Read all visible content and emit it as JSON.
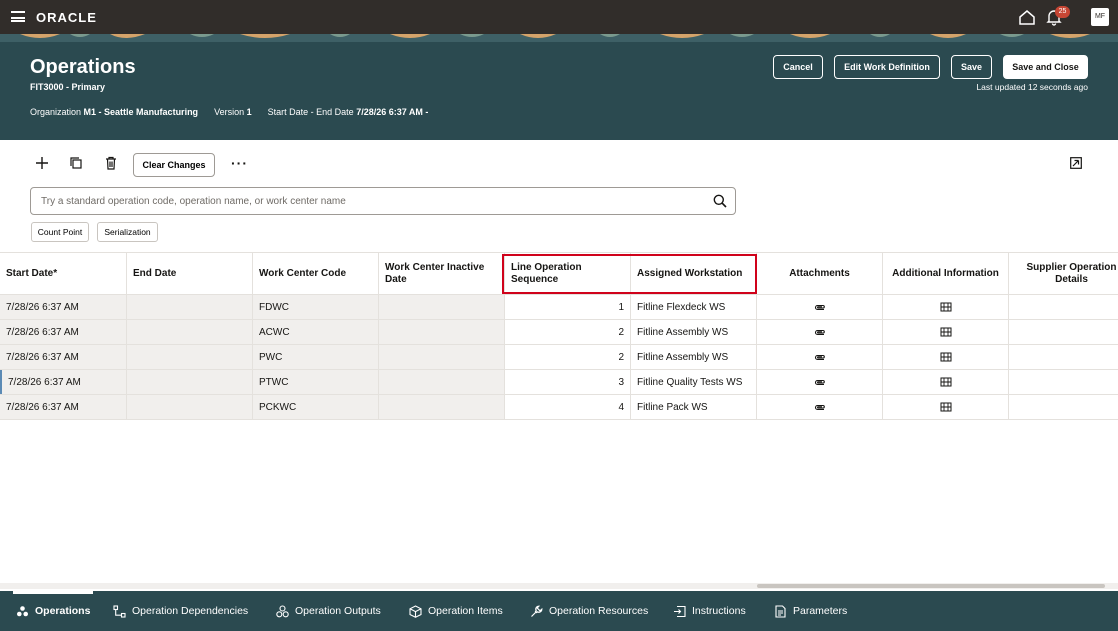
{
  "topbar": {
    "logo": "ORACLE",
    "notification_count": "25",
    "avatar_initials": "MF"
  },
  "header": {
    "title": "Operations",
    "subtitle": "FIT3000 - Primary",
    "organization_label": "Organization",
    "organization_value": "M1 - Seattle Manufacturing",
    "version_label": "Version",
    "version_value": "1",
    "dates_label": "Start Date - End Date",
    "dates_value": "7/28/26 6:37 AM -",
    "last_updated": "Last updated 12 seconds ago",
    "buttons": {
      "cancel": "Cancel",
      "edit_work_definition": "Edit Work Definition",
      "save": "Save",
      "save_and_close": "Save and Close"
    }
  },
  "toolbar": {
    "clear_changes": "Clear Changes"
  },
  "search": {
    "placeholder": "Try a standard operation code, operation name, or work center name"
  },
  "chips": [
    "Count Point",
    "Serialization"
  ],
  "table": {
    "columns": [
      "Start Date*",
      "End Date",
      "Work Center Code",
      "Work Center Inactive Date",
      "Line Operation Sequence",
      "Assigned Workstation",
      "Attachments",
      "Additional Information",
      "Supplier Operation Details"
    ],
    "rows": [
      {
        "start_date": "7/28/26 6:37 AM",
        "end_date": "",
        "work_center_code": "FDWC",
        "inactive_date": "",
        "line_seq": "1",
        "workstation": "Fitline Flexdeck WS"
      },
      {
        "start_date": "7/28/26 6:37 AM",
        "end_date": "",
        "work_center_code": "ACWC",
        "inactive_date": "",
        "line_seq": "2",
        "workstation": "Fitline Assembly WS"
      },
      {
        "start_date": "7/28/26 6:37 AM",
        "end_date": "",
        "work_center_code": "PWC",
        "inactive_date": "",
        "line_seq": "2",
        "workstation": "Fitline Assembly WS"
      },
      {
        "start_date": "7/28/26 6:37 AM",
        "end_date": "",
        "work_center_code": "PTWC",
        "inactive_date": "",
        "line_seq": "3",
        "workstation": "Fitline Quality Tests WS"
      },
      {
        "start_date": "7/28/26 6:37 AM",
        "end_date": "",
        "work_center_code": "PCKWC",
        "inactive_date": "",
        "line_seq": "4",
        "workstation": "Fitline Pack WS"
      }
    ]
  },
  "bottom_tabs": [
    {
      "label": "Operations",
      "icon": "gears-icon",
      "active": true
    },
    {
      "label": "Operation Dependencies",
      "icon": "dependencies-icon"
    },
    {
      "label": "Operation Outputs",
      "icon": "outputs-icon"
    },
    {
      "label": "Operation Items",
      "icon": "box-icon"
    },
    {
      "label": "Operation Resources",
      "icon": "wrench-icon"
    },
    {
      "label": "Instructions",
      "icon": "instructions-icon"
    },
    {
      "label": "Parameters",
      "icon": "parameters-icon"
    }
  ],
  "colors": {
    "banner": "#2b4a50",
    "topbar": "#312d2a",
    "highlight": "#d0021b",
    "badge": "#c74634"
  }
}
